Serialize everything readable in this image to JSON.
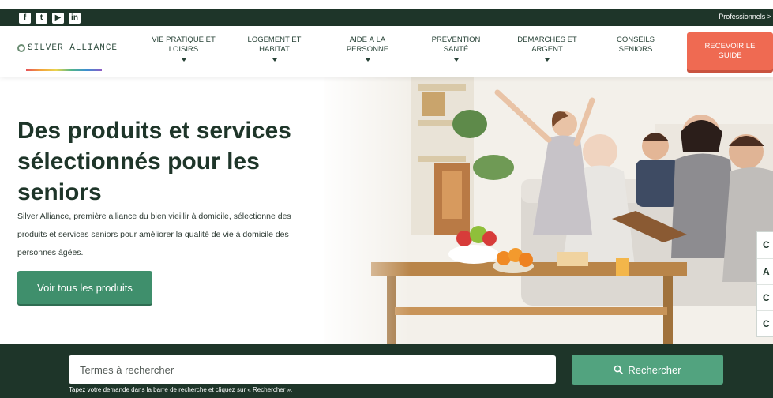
{
  "topbar": {
    "social_icons": [
      {
        "name": "facebook-icon",
        "glyph": "f"
      },
      {
        "name": "twitter-icon",
        "glyph": "t"
      },
      {
        "name": "youtube-icon",
        "glyph": "▶"
      },
      {
        "name": "linkedin-icon",
        "glyph": "in"
      }
    ],
    "professionals_link": "Professionnels >"
  },
  "header": {
    "logo_text": "SILVER ALLIANCE",
    "nav": [
      {
        "label": "VIE PRATIQUE ET\nLOISIRS",
        "dropdown": true
      },
      {
        "label": "LOGEMENT ET\nHABITAT",
        "dropdown": true
      },
      {
        "label": "AIDE À LA\nPERSONNE",
        "dropdown": true
      },
      {
        "label": "PRÉVENTION\nSANTÉ",
        "dropdown": true
      },
      {
        "label": "DÉMARCHES ET\nARGENT",
        "dropdown": true
      },
      {
        "label": "CONSEILS\nSENIORS",
        "dropdown": false
      }
    ],
    "cta_label": "RECEVOIR LE\nGUIDE"
  },
  "hero": {
    "title": "Des produits et services sélectionnés pour les seniors",
    "description": "Silver Alliance, première alliance du bien vieillir à domicile, sélectionne des produits et services seniors pour améliorer la qualité de vie à domicile des personnes âgées.",
    "button_label": "Voir tous les produits",
    "side_tab_items": [
      "C",
      "A",
      "C",
      "C"
    ]
  },
  "search": {
    "placeholder": "Termes à rechercher",
    "button_label": "Rechercher",
    "hint": "Tapez votre demande dans la barre de recherche et cliquez sur « Rechercher »."
  },
  "colors": {
    "dark_green": "#1e3529",
    "button_green": "#3f8f6c",
    "search_green": "#52a37f",
    "cta_orange": "#ef6a52"
  }
}
